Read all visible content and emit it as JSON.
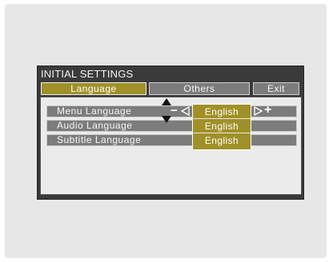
{
  "window": {
    "title": "INITIAL SETTINGS"
  },
  "tabs": [
    {
      "label": "Language",
      "active": true
    },
    {
      "label": "Others",
      "active": false
    },
    {
      "label": "Exit",
      "active": false
    }
  ],
  "settings": [
    {
      "label": "Menu Language",
      "value": "English"
    },
    {
      "label": "Audio Language",
      "value": "English"
    },
    {
      "label": "Subtitle Language",
      "value": "English"
    }
  ],
  "controls": {
    "decrease_glyph": "−",
    "increase_glyph": "+"
  },
  "colors": {
    "highlight": "#a09028",
    "panel": "#3a3a3a",
    "row": "#7c7c7c"
  },
  "icons": [
    "scroll-up-icon",
    "scroll-down-icon",
    "arrow-left-icon",
    "arrow-right-icon"
  ]
}
